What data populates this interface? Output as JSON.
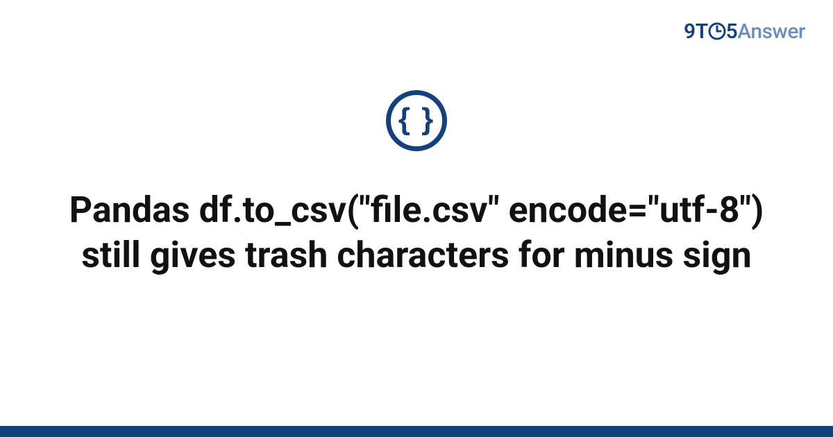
{
  "logo": {
    "part_9": "9",
    "part_T": "T",
    "part_5": "5",
    "part_answer": "Answer"
  },
  "icon": {
    "name": "braces-icon",
    "glyph": "{ }"
  },
  "title": "Pandas df.to_csv(\"file.csv\" encode=\"utf-8\") still gives trash characters for minus sign",
  "colors": {
    "brand_primary": "#14407b",
    "brand_secondary": "#6d8eb8",
    "text": "#111111",
    "background": "#ffffff"
  }
}
